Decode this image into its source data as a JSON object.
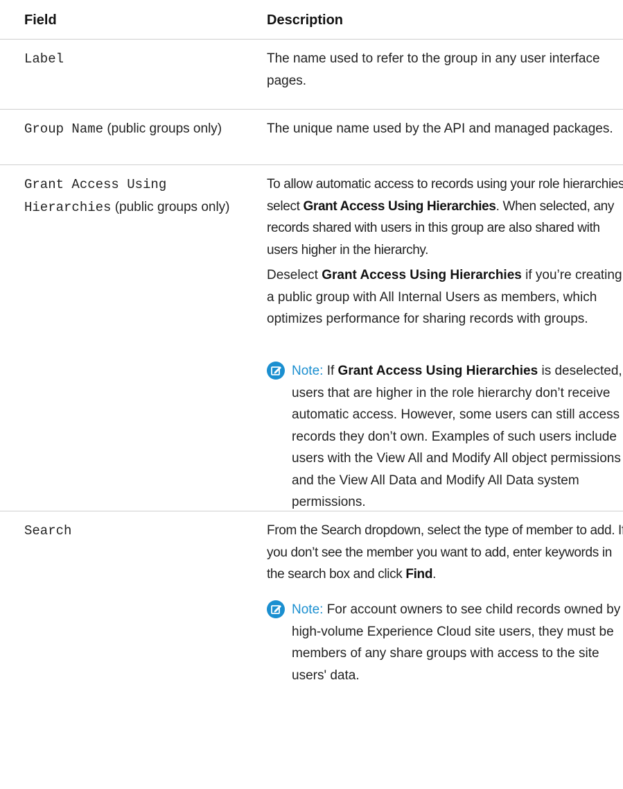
{
  "table": {
    "header": {
      "field": "Field",
      "description": "Description"
    },
    "rows": [
      {
        "field_code": "Label",
        "field_suffix": "",
        "description": "The name used to refer to the group in any user interface pages."
      },
      {
        "field_code": "Group Name",
        "field_suffix": "(public groups only)",
        "description": "The unique name used by the API and managed packages."
      },
      {
        "field_code_line1": "Grant Access Using",
        "field_code_line2": "Hierarchies",
        "field_suffix": "(public groups only)",
        "desc1_part1": "To allow automatic access to records using your role hierarchies, select ",
        "desc1_bold": "Grant Access Using Hierarchies",
        "desc1_part2": ". When selected, any records shared with users in this group are also shared with users higher in the hierarchy.",
        "desc2_part1": "Deselect ",
        "desc2_bold": "Grant Access Using Hierarchies",
        "desc2_part2": " if you’re creating a public group with All Internal Users as members, which optimizes performance for sharing records with groups.",
        "note_label": "Note:",
        "note_part1": " If ",
        "note_bold": "Grant Access Using Hierarchies",
        "note_part2": " is deselected, users that are higher in the role hierarchy don’t receive automatic access. However, some users can still access records they don’t own. Examples of such users include users with the View All and Modify All object permissions and the View All Data and Modify All Data system permissions."
      },
      {
        "field_code": "Search",
        "desc_part1": "From the Search dropdown, select the type of member to add. If you don’t see the member you want to add, enter keywords in the search box and click ",
        "desc_bold": "Find",
        "desc_part2": ".",
        "note_label": "Note:",
        "note_text": " For account owners to see child records owned by high-volume Experience Cloud site users, they must be members of any share groups with access to the site users' data."
      }
    ]
  },
  "colors": {
    "note_accent": "#1b8fd0",
    "divider": "#cfcfcf",
    "text": "#222222"
  },
  "icons": {
    "note": "note-edit-icon"
  }
}
